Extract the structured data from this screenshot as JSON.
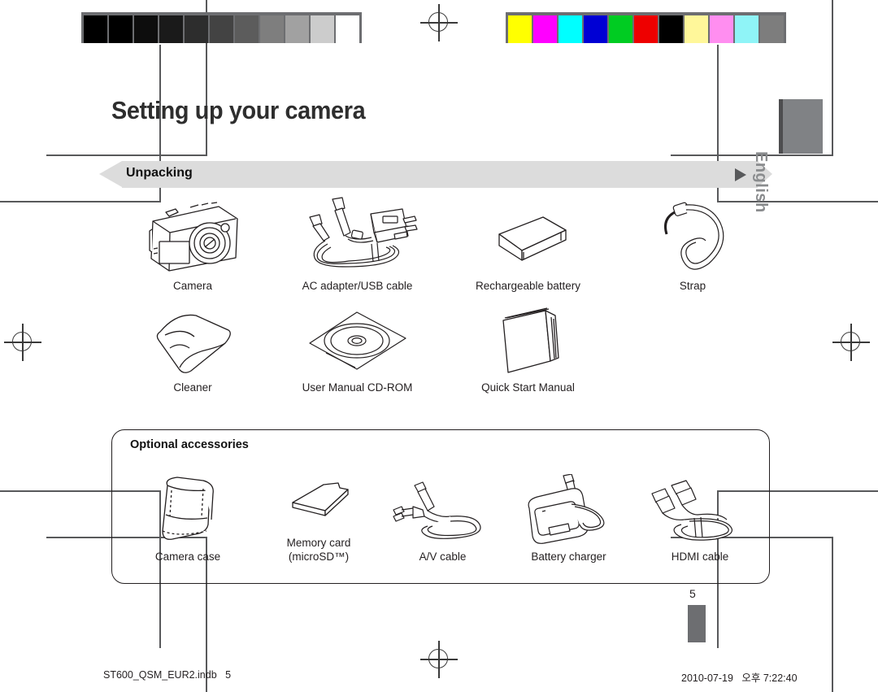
{
  "document": {
    "title": "Setting up your camera",
    "section_label": "Unpacking",
    "language_tab": "English",
    "page_number": "5"
  },
  "calibration": {
    "grayscale_strip": [
      "#000000",
      "#000000",
      "#0d0d0d",
      "#1a1a1a",
      "#2d2d2d",
      "#434343",
      "#5c5c5c",
      "#7e7e7e",
      "#a1a1a1",
      "#cccccc",
      "#ffffff"
    ],
    "color_strip": [
      "#ffff00",
      "#ff00ff",
      "#00ffff",
      "#0000d4",
      "#00cc22",
      "#ee0000",
      "#000000",
      "#fff79a",
      "#ff8ef0",
      "#8ff4f7",
      "#7d7d7d"
    ]
  },
  "unpacking": {
    "row1": [
      {
        "caption": "Camera",
        "icon": "camera-icon"
      },
      {
        "caption": "AC adapter/USB cable",
        "icon": "ac-adapter-usb-cable-icon"
      },
      {
        "caption": "Rechargeable battery",
        "icon": "battery-icon"
      },
      {
        "caption": "Strap",
        "icon": "strap-icon"
      }
    ],
    "row2": [
      {
        "caption": "Cleaner",
        "icon": "cleaner-cloth-icon"
      },
      {
        "caption": "User Manual CD-ROM",
        "icon": "cd-rom-icon"
      },
      {
        "caption": "Quick Start Manual",
        "icon": "manual-booklet-icon"
      }
    ]
  },
  "optional": {
    "heading": "Optional accessories",
    "items": [
      {
        "caption": "Camera case",
        "caption2": "",
        "icon": "camera-case-icon"
      },
      {
        "caption": "Memory card",
        "caption2": "(microSD™)",
        "icon": "memory-card-icon"
      },
      {
        "caption": "A/V cable",
        "caption2": "",
        "icon": "av-cable-icon"
      },
      {
        "caption": "Battery charger",
        "caption2": "",
        "icon": "battery-charger-icon"
      },
      {
        "caption": "HDMI cable",
        "caption2": "",
        "icon": "hdmi-cable-icon"
      }
    ]
  },
  "footer": {
    "left": "ST600_QSM_EUR2.indb   5",
    "right": "2010-07-19   오후 7:22:40"
  }
}
